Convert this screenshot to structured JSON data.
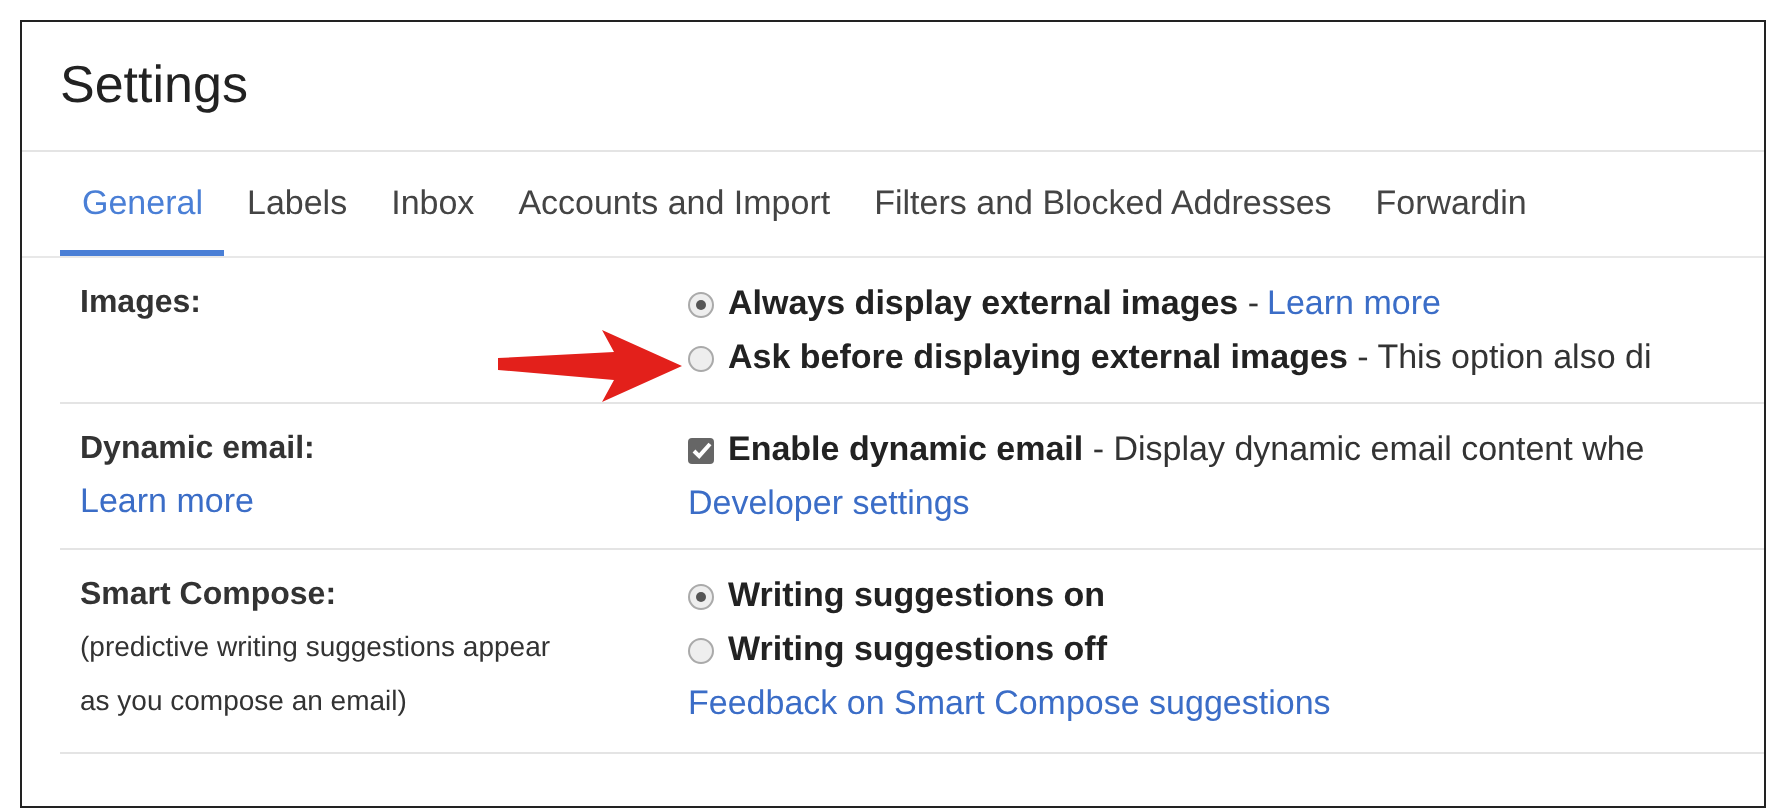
{
  "title": "Settings",
  "tabs": [
    {
      "label": "General",
      "selected": true
    },
    {
      "label": "Labels",
      "selected": false
    },
    {
      "label": "Inbox",
      "selected": false
    },
    {
      "label": "Accounts and Import",
      "selected": false
    },
    {
      "label": "Filters and Blocked Addresses",
      "selected": false
    },
    {
      "label": "Forwardin",
      "selected": false
    }
  ],
  "sections": [
    {
      "label": "Images:",
      "options": [
        {
          "kind": "radio",
          "selected": true,
          "text": "**Always display external images** - ",
          "link": "Learn more",
          "arrow": false
        },
        {
          "kind": "radio",
          "selected": false,
          "text": "**Ask before displaying external images** - This option also di",
          "arrow": true
        }
      ]
    },
    {
      "label": "Dynamic email:",
      "label_link": "Learn more",
      "options": [
        {
          "kind": "checkbox",
          "checked": true,
          "text": "**Enable dynamic email** - Display dynamic email content whe"
        },
        {
          "kind": "link",
          "text": "Developer settings"
        }
      ]
    },
    {
      "label": "Smart Compose:",
      "note": "(predictive writing suggestions appear as you compose an email)",
      "options": [
        {
          "kind": "radio",
          "selected": true,
          "text": "**Writing suggestions on**"
        },
        {
          "kind": "radio",
          "selected": false,
          "text": "**Writing suggestions off**"
        },
        {
          "kind": "link",
          "text": "Feedback on Smart Compose suggestions"
        }
      ]
    }
  ]
}
